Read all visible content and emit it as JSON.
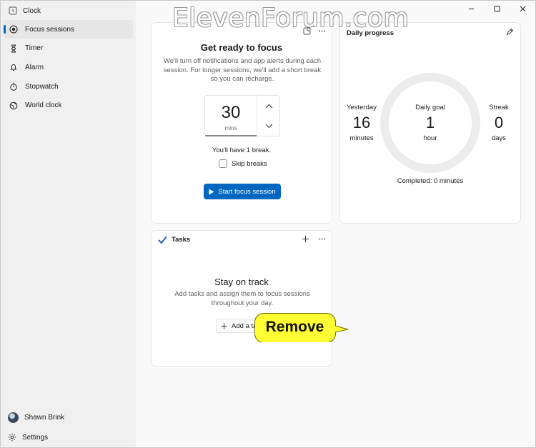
{
  "app": {
    "title": "Clock"
  },
  "sidebar": {
    "items": [
      {
        "label": "Focus sessions",
        "icon": "focus-icon",
        "active": true
      },
      {
        "label": "Timer",
        "icon": "hourglass-icon"
      },
      {
        "label": "Alarm",
        "icon": "bell-icon"
      },
      {
        "label": "Stopwatch",
        "icon": "stopwatch-icon"
      },
      {
        "label": "World clock",
        "icon": "globe-icon"
      }
    ],
    "user": {
      "name": "Shawn Brink"
    },
    "settings_label": "Settings"
  },
  "focus": {
    "title": "Get ready to focus",
    "description": "We'll turn off notifications and app alerts during each session. For longer sessions, we'll add a short break so you can recharge.",
    "stepper_value": "30",
    "stepper_unit": "mins",
    "break_text": "You'll have 1 break.",
    "skip_label": "Skip breaks",
    "start_label": "Start focus session"
  },
  "progress": {
    "title": "Daily progress",
    "yesterday": {
      "label": "Yesterday",
      "value": "16",
      "unit": "minutes"
    },
    "goal": {
      "label": "Daily goal",
      "value": "1",
      "unit": "hour"
    },
    "streak": {
      "label": "Streak",
      "value": "0",
      "unit": "days"
    },
    "completed": "Completed: 0 minutes"
  },
  "tasks": {
    "title": "Tasks",
    "heading": "Stay on track",
    "description": "Add tasks and assign them to focus sessions throughout your day.",
    "add_label": "Add a task"
  },
  "watermark": "ElevenForum.com",
  "callout": {
    "text": "Remove"
  },
  "colors": {
    "accent": "#0067c0",
    "callout_fill": "#ffff33"
  }
}
